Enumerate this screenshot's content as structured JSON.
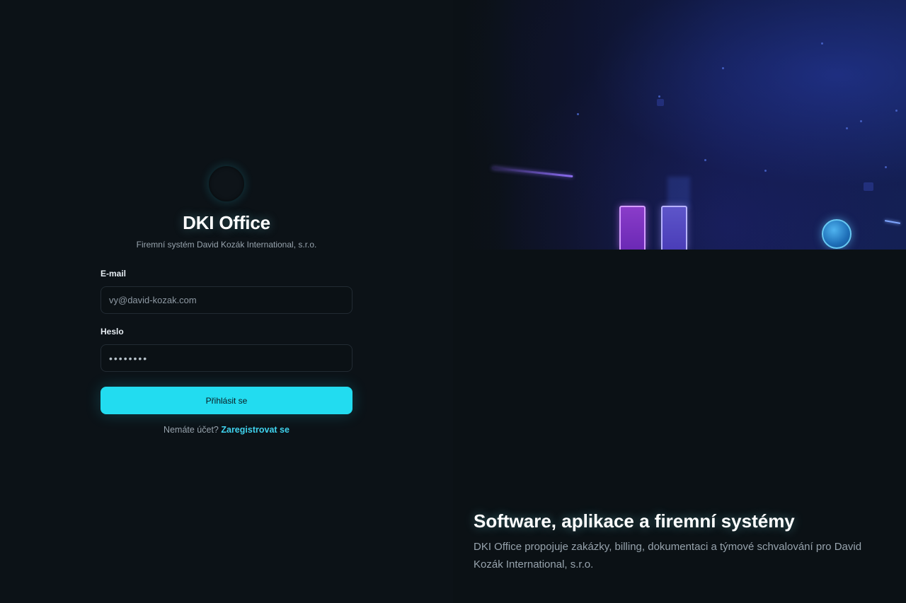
{
  "app": {
    "title": "DKI Office",
    "subtitle": "Firemní systém David Kozák International, s.r.o."
  },
  "form": {
    "email_label": "E-mail",
    "email_placeholder": "vy@david-kozak.com",
    "password_label": "Heslo",
    "password_value": "••••••••",
    "submit_label": "Přihlásit se",
    "register_prompt": "Nemáte účet?",
    "register_link": "Zaregistrovat se"
  },
  "hero": {
    "title": "Software, aplikace a firemní systémy",
    "description": "DKI Office propojuje zakázky, billing, dokumentaci a týmové schvalování pro David Kozák International, s.r.o."
  },
  "colors": {
    "accent": "#22dcf0",
    "link": "#3fd3ee",
    "background": "#0b1116"
  }
}
